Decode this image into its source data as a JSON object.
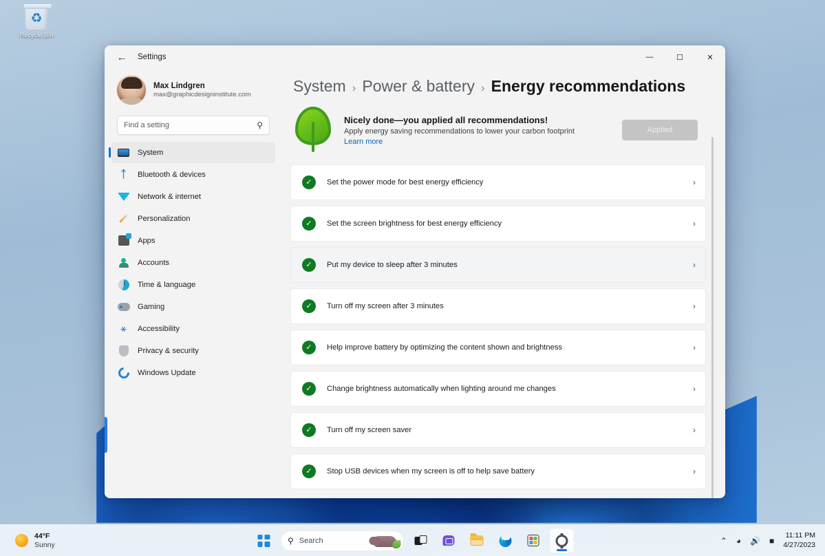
{
  "desktop": {
    "recycle_bin_label": "Recycle Bin",
    "recycle_bin_icon": "recycle-bin-icon"
  },
  "window": {
    "app_title": "Settings",
    "back_icon": "back-arrow-icon",
    "controls": {
      "minimize": "—",
      "maximize": "☐",
      "close": "✕"
    }
  },
  "sidebar": {
    "account": {
      "name": "Max Lindgren",
      "email": "max@graphicdesigninstitute.com",
      "avatar_icon": "user-avatar"
    },
    "search": {
      "placeholder": "Find a setting",
      "icon": "search-icon"
    },
    "items": [
      {
        "label": "System",
        "icon": "monitor-icon",
        "active": true
      },
      {
        "label": "Bluetooth & devices",
        "icon": "bluetooth-icon",
        "active": false
      },
      {
        "label": "Network & internet",
        "icon": "wifi-icon",
        "active": false
      },
      {
        "label": "Personalization",
        "icon": "paintbrush-icon",
        "active": false
      },
      {
        "label": "Apps",
        "icon": "apps-icon",
        "active": false
      },
      {
        "label": "Accounts",
        "icon": "person-icon",
        "active": false
      },
      {
        "label": "Time & language",
        "icon": "clock-icon",
        "active": false
      },
      {
        "label": "Gaming",
        "icon": "gamepad-icon",
        "active": false
      },
      {
        "label": "Accessibility",
        "icon": "accessibility-icon",
        "active": false
      },
      {
        "label": "Privacy & security",
        "icon": "shield-icon",
        "active": false
      },
      {
        "label": "Windows Update",
        "icon": "update-icon",
        "active": false
      }
    ]
  },
  "content": {
    "breadcrumb": [
      {
        "label": "System",
        "current": false
      },
      {
        "label": "Power & battery",
        "current": false
      },
      {
        "label": "Energy recommendations",
        "current": true
      }
    ],
    "breadcrumb_separator": "›",
    "hero": {
      "icon": "leaf-icon",
      "title": "Nicely done—you applied all recommendations!",
      "subtitle": "Apply energy saving recommendations to lower your carbon footprint",
      "link": "Learn more",
      "button_label": "Applied",
      "button_disabled": true
    },
    "recommendations": [
      {
        "label": "Set the power mode for best energy efficiency",
        "applied": true,
        "hovered": false
      },
      {
        "label": "Set the screen brightness for best energy efficiency",
        "applied": true,
        "hovered": false
      },
      {
        "label": "Put my device to sleep after 3 minutes",
        "applied": true,
        "hovered": true
      },
      {
        "label": "Turn off my screen after 3 minutes",
        "applied": true,
        "hovered": false
      },
      {
        "label": "Help improve battery by optimizing the content shown and brightness",
        "applied": true,
        "hovered": false
      },
      {
        "label": "Change brightness automatically when lighting around me changes",
        "applied": true,
        "hovered": false
      },
      {
        "label": "Turn off my screen saver",
        "applied": true,
        "hovered": false
      },
      {
        "label": "Stop USB devices when my screen is off to help save battery",
        "applied": true,
        "hovered": false
      }
    ],
    "check_glyph": "✓",
    "chevron_glyph": "›"
  },
  "taskbar": {
    "weather": {
      "temperature": "44°F",
      "condition": "Sunny",
      "icon": "sun-icon"
    },
    "start_label": "start-button",
    "search": {
      "label": "Search",
      "placeholder": "Search",
      "icon": "search-icon",
      "decoration_icon": "hippo-icon"
    },
    "buttons": [
      {
        "name": "task-view",
        "label": "Task View",
        "active": false
      },
      {
        "name": "chat",
        "label": "Chat",
        "active": false
      },
      {
        "name": "file-explorer",
        "label": "File Explorer",
        "active": false
      },
      {
        "name": "edge",
        "label": "Microsoft Edge",
        "active": false
      },
      {
        "name": "store",
        "label": "Microsoft Store",
        "active": false
      },
      {
        "name": "settings",
        "label": "Settings",
        "active": true
      }
    ],
    "tray": {
      "chevron": "⌃",
      "wifi_icon": "wifi-icon",
      "volume_icon": "speaker-icon",
      "battery_icon": "battery-icon",
      "time": "11:11 PM",
      "date": "4/27/2023"
    }
  },
  "colors": {
    "accent": "#0d6fd1",
    "link": "#0067c0",
    "success": "#0f7a22",
    "window_bg": "#f3f3f3",
    "desktop_bg": "#9fbcd6"
  }
}
